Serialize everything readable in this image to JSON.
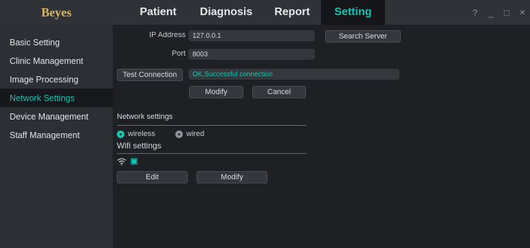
{
  "app": {
    "logo": "Beyes",
    "nav": [
      {
        "label": "Patient"
      },
      {
        "label": "Diagnosis"
      },
      {
        "label": "Report"
      },
      {
        "label": "Setting"
      }
    ],
    "window_controls": {
      "help": "?",
      "minimize": "_",
      "maximize": "□",
      "close": "×"
    },
    "accent_color": "#19c2b0",
    "logo_color": "#d8b563"
  },
  "sidebar": {
    "items": [
      {
        "label": "Basic Setting"
      },
      {
        "label": "Clinic Management"
      },
      {
        "label": "Image Processing"
      },
      {
        "label": "Network Settings"
      },
      {
        "label": "Device Management"
      },
      {
        "label": "Staff Management"
      }
    ],
    "active": "Network Settings"
  },
  "server": {
    "ip_label": "IP Address",
    "ip_value": "127.0.0.1",
    "search_button": "Search Server",
    "port_label": "Port",
    "port_value": "8003",
    "test_button": "Test Connection",
    "status": "OK,Successful connection",
    "modify_button": "Modify",
    "cancel_button": "Cancel"
  },
  "network": {
    "title": "Network settings",
    "wireless_label": "wireless",
    "wired_label": "wired",
    "selected": "wireless",
    "wifi_title": "Wifi settings",
    "wifi_icon": "wifi-icon",
    "wifi_checked": true,
    "edit_button": "Edit",
    "modify_button": "Modify"
  }
}
